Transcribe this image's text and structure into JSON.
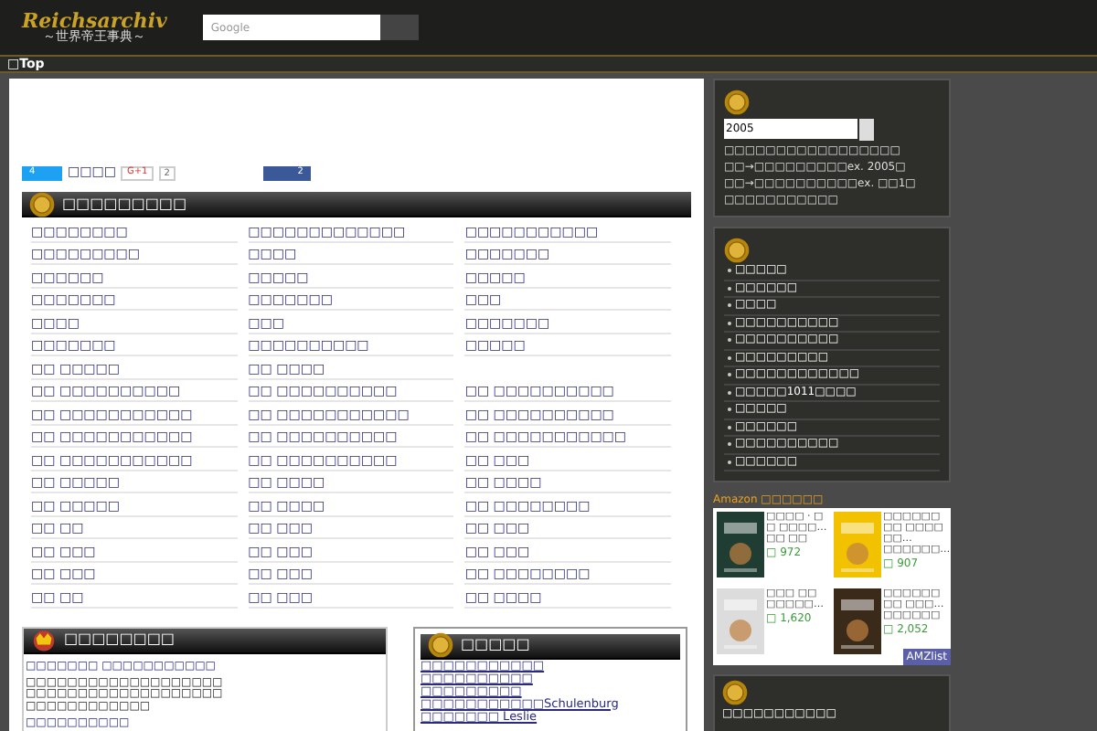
{
  "header": {
    "logo_title": "Reichsarchiv",
    "logo_subtitle": "～世界帝王事典～",
    "search": {
      "placeholder": "Google"
    }
  },
  "nav": {
    "items": [
      "□Top"
    ]
  },
  "social": {
    "tweet_count": "4",
    "label": "□□□□",
    "gplus": "G+1",
    "gplus_count": "2",
    "like_count": "2"
  },
  "index": {
    "title": "□□□□□□□□□",
    "columns": [
      [
        "□□□□□□□□",
        "□□□□□□□□□",
        "□□□□□□",
        "□□□□□□□",
        "□□□□",
        "□□□□□□□",
        "□□ □□□□□",
        "□□ □□□□□□□□□□",
        "□□ □□□□□□□□□□□",
        "□□ □□□□□□□□□□□",
        "□□ □□□□□□□□□□□",
        "□□ □□□□□",
        "□□ □□□□□",
        "□□ □□",
        "□□ □□□",
        "□□ □□□",
        "□□ □□"
      ],
      [
        "□□□□□□□□□□□□□",
        "□□□□",
        "□□□□□",
        "□□□□□□□",
        "□□□",
        "□□□□□□□□□□",
        "□□ □□□□",
        "□□ □□□□□□□□□□",
        "□□ □□□□□□□□□□□",
        "□□ □□□□□□□□□□",
        "□□ □□□□□□□□□□",
        "□□ □□□□",
        "□□ □□□□",
        "□□ □□□",
        "□□ □□□",
        "□□ □□□",
        "□□ □□□"
      ],
      [
        "□□□□□□□□□□□",
        "□□□□□□□",
        "□□□□□",
        "□□□",
        "□□□□□□□",
        "□□□□□",
        "",
        "□□ □□□□□□□□□□",
        "□□ □□□□□□□□□□",
        "□□ □□□□□□□□□□□",
        "□□ □□□",
        "□□ □□□□",
        "□□ □□□□□□□□",
        "□□ □□□",
        "□□ □□□",
        "□□ □□□□□□□□",
        "□□ □□□□"
      ]
    ]
  },
  "news": {
    "title": "□□□□□□□□",
    "lead": "□□□□□□□ □□□□□□□□□□□",
    "body": "□□□□□□□□□□□□□□□□□□□□□□□□□□□□□□□□□□□□□□□□□□□□□□□□□□",
    "more": "□□□□□□□□□□"
  },
  "links": {
    "title": "□□□□□",
    "items": [
      "□□□□□□□□□□□",
      "□□□□□□□□□□",
      "□□□□□□□□□",
      "□□□□□□□□□□□Schulenburg",
      "□□□□□□□ Leslie"
    ]
  },
  "year_search": {
    "value": "2005",
    "lines": [
      "□□□□□□□□□□□□□□□□□",
      "□□→□□□□□□□□□ex. 2005□",
      "□□→□□□□□□□□□□ex. □□1□",
      "□□□□□□□□□□□"
    ]
  },
  "menu": {
    "items": [
      "□□□□□",
      "□□□□□□",
      "□□□□",
      "□□□□□□□□□□",
      "□□□□□□□□□□",
      "□□□□□□□□□",
      "□□□□□□□□□□□□",
      "□□□□□1011□□□□",
      "□□□□□",
      "□□□□□□",
      "□□□□□□□□□□",
      "□□□□□□"
    ]
  },
  "amazon": {
    "label": "Amazon □□□□□□",
    "badge": "AMZlist",
    "products": [
      {
        "title": "□□□□ · □□ □□□□…",
        "author": "□□ □□",
        "price": "□ 972"
      },
      {
        "title": "□□□□□□□□ □□□□□□…",
        "author": "□□□□□□…",
        "price": "□ 907"
      },
      {
        "title": "□□□ □□ □□□□□…",
        "price": "□ 1,620"
      },
      {
        "title": "□□□□□□ □□ □□□…",
        "author": "□□□□□□",
        "price": "□ 2,052"
      }
    ]
  },
  "bottom_box": {
    "items": [
      "□□□□□□□□□□□"
    ]
  }
}
